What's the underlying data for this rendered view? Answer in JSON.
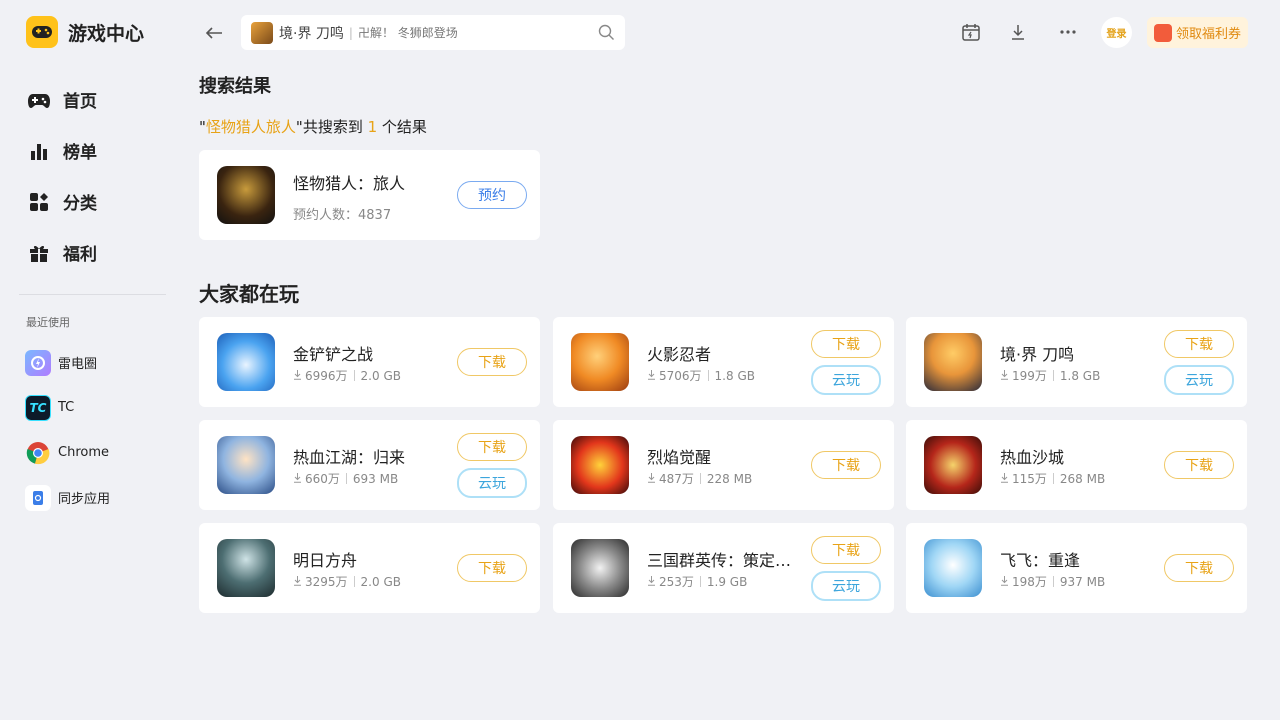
{
  "app": {
    "title": "游戏中心"
  },
  "sidebar": {
    "nav": [
      {
        "label": "首页",
        "icon": "gamepad-icon"
      },
      {
        "label": "榜单",
        "icon": "ranking-icon"
      },
      {
        "label": "分类",
        "icon": "category-icon"
      },
      {
        "label": "福利",
        "icon": "gift-icon"
      }
    ],
    "recent_title": "最近使用",
    "recent": [
      {
        "label": "雷电圈",
        "icon": "leidian-icon"
      },
      {
        "label": "TC",
        "icon": "tc-icon"
      },
      {
        "label": "Chrome",
        "icon": "chrome-icon"
      },
      {
        "label": "同步应用",
        "icon": "sync-app-icon"
      }
    ]
  },
  "topbar": {
    "search": {
      "game": "境·界 刀鸣",
      "separator": "|",
      "slogan": "卍解！ 冬狮郎登场"
    },
    "login_label": "登录",
    "coupon_label": "领取福利券"
  },
  "search_results": {
    "title": "搜索结果",
    "query_prefix": "\"",
    "query": "怪物猎人旅人",
    "query_suffix": "\"共搜索到 ",
    "count": "1",
    "count_suffix": " 个结果",
    "items": [
      {
        "name": "怪物猎人：旅人",
        "meta": "预约人数：4837",
        "button": "预约"
      }
    ]
  },
  "popular": {
    "title": "大家都在玩",
    "items": [
      {
        "name": "金铲铲之战",
        "downloads": "6996万",
        "size": "2.0 GB",
        "download_label": "下载",
        "cloud_label": ""
      },
      {
        "name": "火影忍者",
        "downloads": "5706万",
        "size": "1.8 GB",
        "download_label": "下载",
        "cloud_label": "云玩"
      },
      {
        "name": "境·界 刀鸣",
        "downloads": "199万",
        "size": "1.8 GB",
        "download_label": "下载",
        "cloud_label": "云玩"
      },
      {
        "name": "热血江湖：归来",
        "downloads": "660万",
        "size": "693 MB",
        "download_label": "下载",
        "cloud_label": "云玩"
      },
      {
        "name": "烈焰觉醒",
        "downloads": "487万",
        "size": "228 MB",
        "download_label": "下载",
        "cloud_label": ""
      },
      {
        "name": "热血沙城",
        "downloads": "115万",
        "size": "268 MB",
        "download_label": "下载",
        "cloud_label": ""
      },
      {
        "name": "明日方舟",
        "downloads": "3295万",
        "size": "2.0 GB",
        "download_label": "下载",
        "cloud_label": ""
      },
      {
        "name": "三国群英传：策定…",
        "downloads": "253万",
        "size": "1.9 GB",
        "download_label": "下载",
        "cloud_label": "云玩"
      },
      {
        "name": "飞飞：重逢",
        "downloads": "198万",
        "size": "937 MB",
        "download_label": "下载",
        "cloud_label": ""
      }
    ]
  },
  "colors": {
    "accent": "#e8a317",
    "cloud": "#3ca5dc",
    "reserve": "#3b7ee8",
    "background": "#f0f1f5"
  }
}
